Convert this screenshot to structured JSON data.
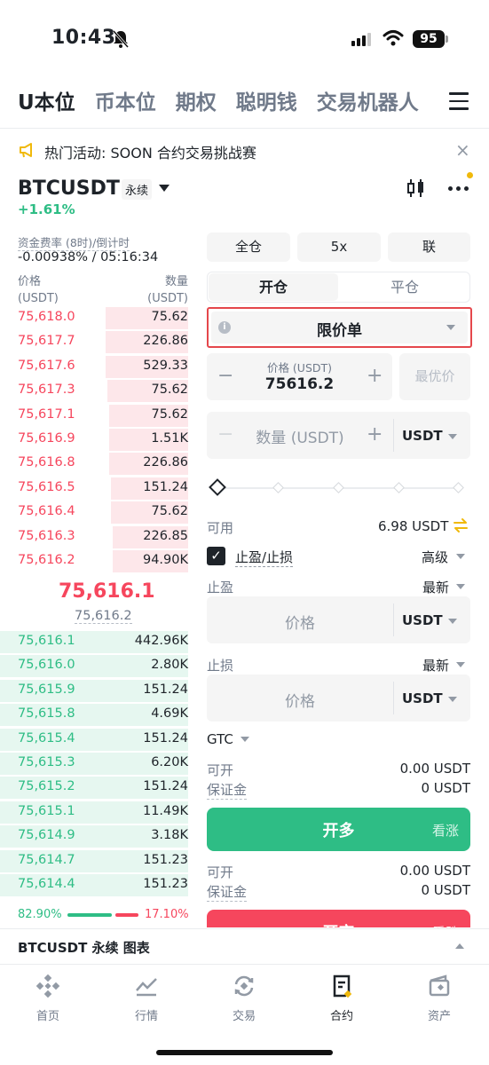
{
  "status_bar": {
    "time": "10:43",
    "battery": "95"
  },
  "top_tabs": [
    "U本位",
    "币本位",
    "期权",
    "聪明钱",
    "交易机器人"
  ],
  "banner": {
    "text": "热门活动: SOON 合约交易挑战赛"
  },
  "symbol": {
    "name": "BTCUSDT",
    "type": "永续",
    "change": "+1.61%"
  },
  "funding": {
    "label": "资金费率 (8时)/倒计时",
    "value": "-0.00938% / 05:16:34"
  },
  "orderbook": {
    "price_header": [
      "价格",
      "(USDT)"
    ],
    "qty_header": [
      "数量",
      "(USDT)"
    ],
    "asks": [
      {
        "price": "75,618.0",
        "qty": "75.62",
        "depth": 0.44
      },
      {
        "price": "75,617.7",
        "qty": "226.86",
        "depth": 0.44
      },
      {
        "price": "75,617.6",
        "qty": "529.33",
        "depth": 0.44
      },
      {
        "price": "75,617.3",
        "qty": "75.62",
        "depth": 0.43
      },
      {
        "price": "75,617.1",
        "qty": "75.62",
        "depth": 0.42
      },
      {
        "price": "75,616.9",
        "qty": "1.51K",
        "depth": 0.42
      },
      {
        "price": "75,616.8",
        "qty": "226.86",
        "depth": 0.42
      },
      {
        "price": "75,616.5",
        "qty": "151.24",
        "depth": 0.41
      },
      {
        "price": "75,616.4",
        "qty": "75.62",
        "depth": 0.41
      },
      {
        "price": "75,616.3",
        "qty": "226.85",
        "depth": 0.4
      },
      {
        "price": "75,616.2",
        "qty": "94.90K",
        "depth": 0.4
      }
    ],
    "last_price": "75,616.1",
    "mark_price": "75,616.2",
    "bids": [
      {
        "price": "75,616.1",
        "qty": "442.96K",
        "depth": 1.0
      },
      {
        "price": "75,616.0",
        "qty": "2.80K",
        "depth": 1.0
      },
      {
        "price": "75,615.9",
        "qty": "151.24",
        "depth": 1.0
      },
      {
        "price": "75,615.8",
        "qty": "4.69K",
        "depth": 1.0
      },
      {
        "price": "75,615.4",
        "qty": "151.24",
        "depth": 1.0
      },
      {
        "price": "75,615.3",
        "qty": "6.20K",
        "depth": 1.0
      },
      {
        "price": "75,615.2",
        "qty": "151.24",
        "depth": 1.0
      },
      {
        "price": "75,615.1",
        "qty": "11.49K",
        "depth": 1.0
      },
      {
        "price": "75,614.9",
        "qty": "3.18K",
        "depth": 1.0
      },
      {
        "price": "75,614.7",
        "qty": "151.23",
        "depth": 1.0
      },
      {
        "price": "75,614.4",
        "qty": "151.23",
        "depth": 1.0
      }
    ],
    "buy_ratio": "82.90%",
    "sell_ratio": "17.10%"
  },
  "order_panel": {
    "margin_mode": "全仓",
    "leverage": "5x",
    "mode": "联",
    "open_tab": "开仓",
    "close_tab": "平仓",
    "order_type": "限价单",
    "price_label": "价格 (USDT)",
    "price_value": "75616.2",
    "best_price": "最优价",
    "qty_placeholder": "数量 (USDT)",
    "unit": "USDT",
    "available_label": "可用",
    "available_value": "6.98 USDT",
    "tpsl_label": "止盈/止损",
    "advanced": "高级",
    "tp_label": "止盈",
    "sl_label": "止损",
    "latest": "最新",
    "price_placeholder": "价格",
    "tif": "GTC",
    "can_open_label": "可开",
    "margin_label": "保证金",
    "long_can_open": "0.00 USDT",
    "long_margin": "0 USDT",
    "long_button": "开多",
    "long_sub": "看涨",
    "short_can_open": "0.00 USDT",
    "short_margin": "0 USDT",
    "short_button": "开空",
    "short_sub": "看跌"
  },
  "chart_bar": {
    "label": "BTCUSDT 永续 图表"
  },
  "bottom_nav": [
    {
      "label": "首页",
      "icon": "home-icon"
    },
    {
      "label": "行情",
      "icon": "markets-icon"
    },
    {
      "label": "交易",
      "icon": "trade-icon"
    },
    {
      "label": "合约",
      "icon": "futures-icon"
    },
    {
      "label": "资产",
      "icon": "wallet-icon"
    }
  ]
}
